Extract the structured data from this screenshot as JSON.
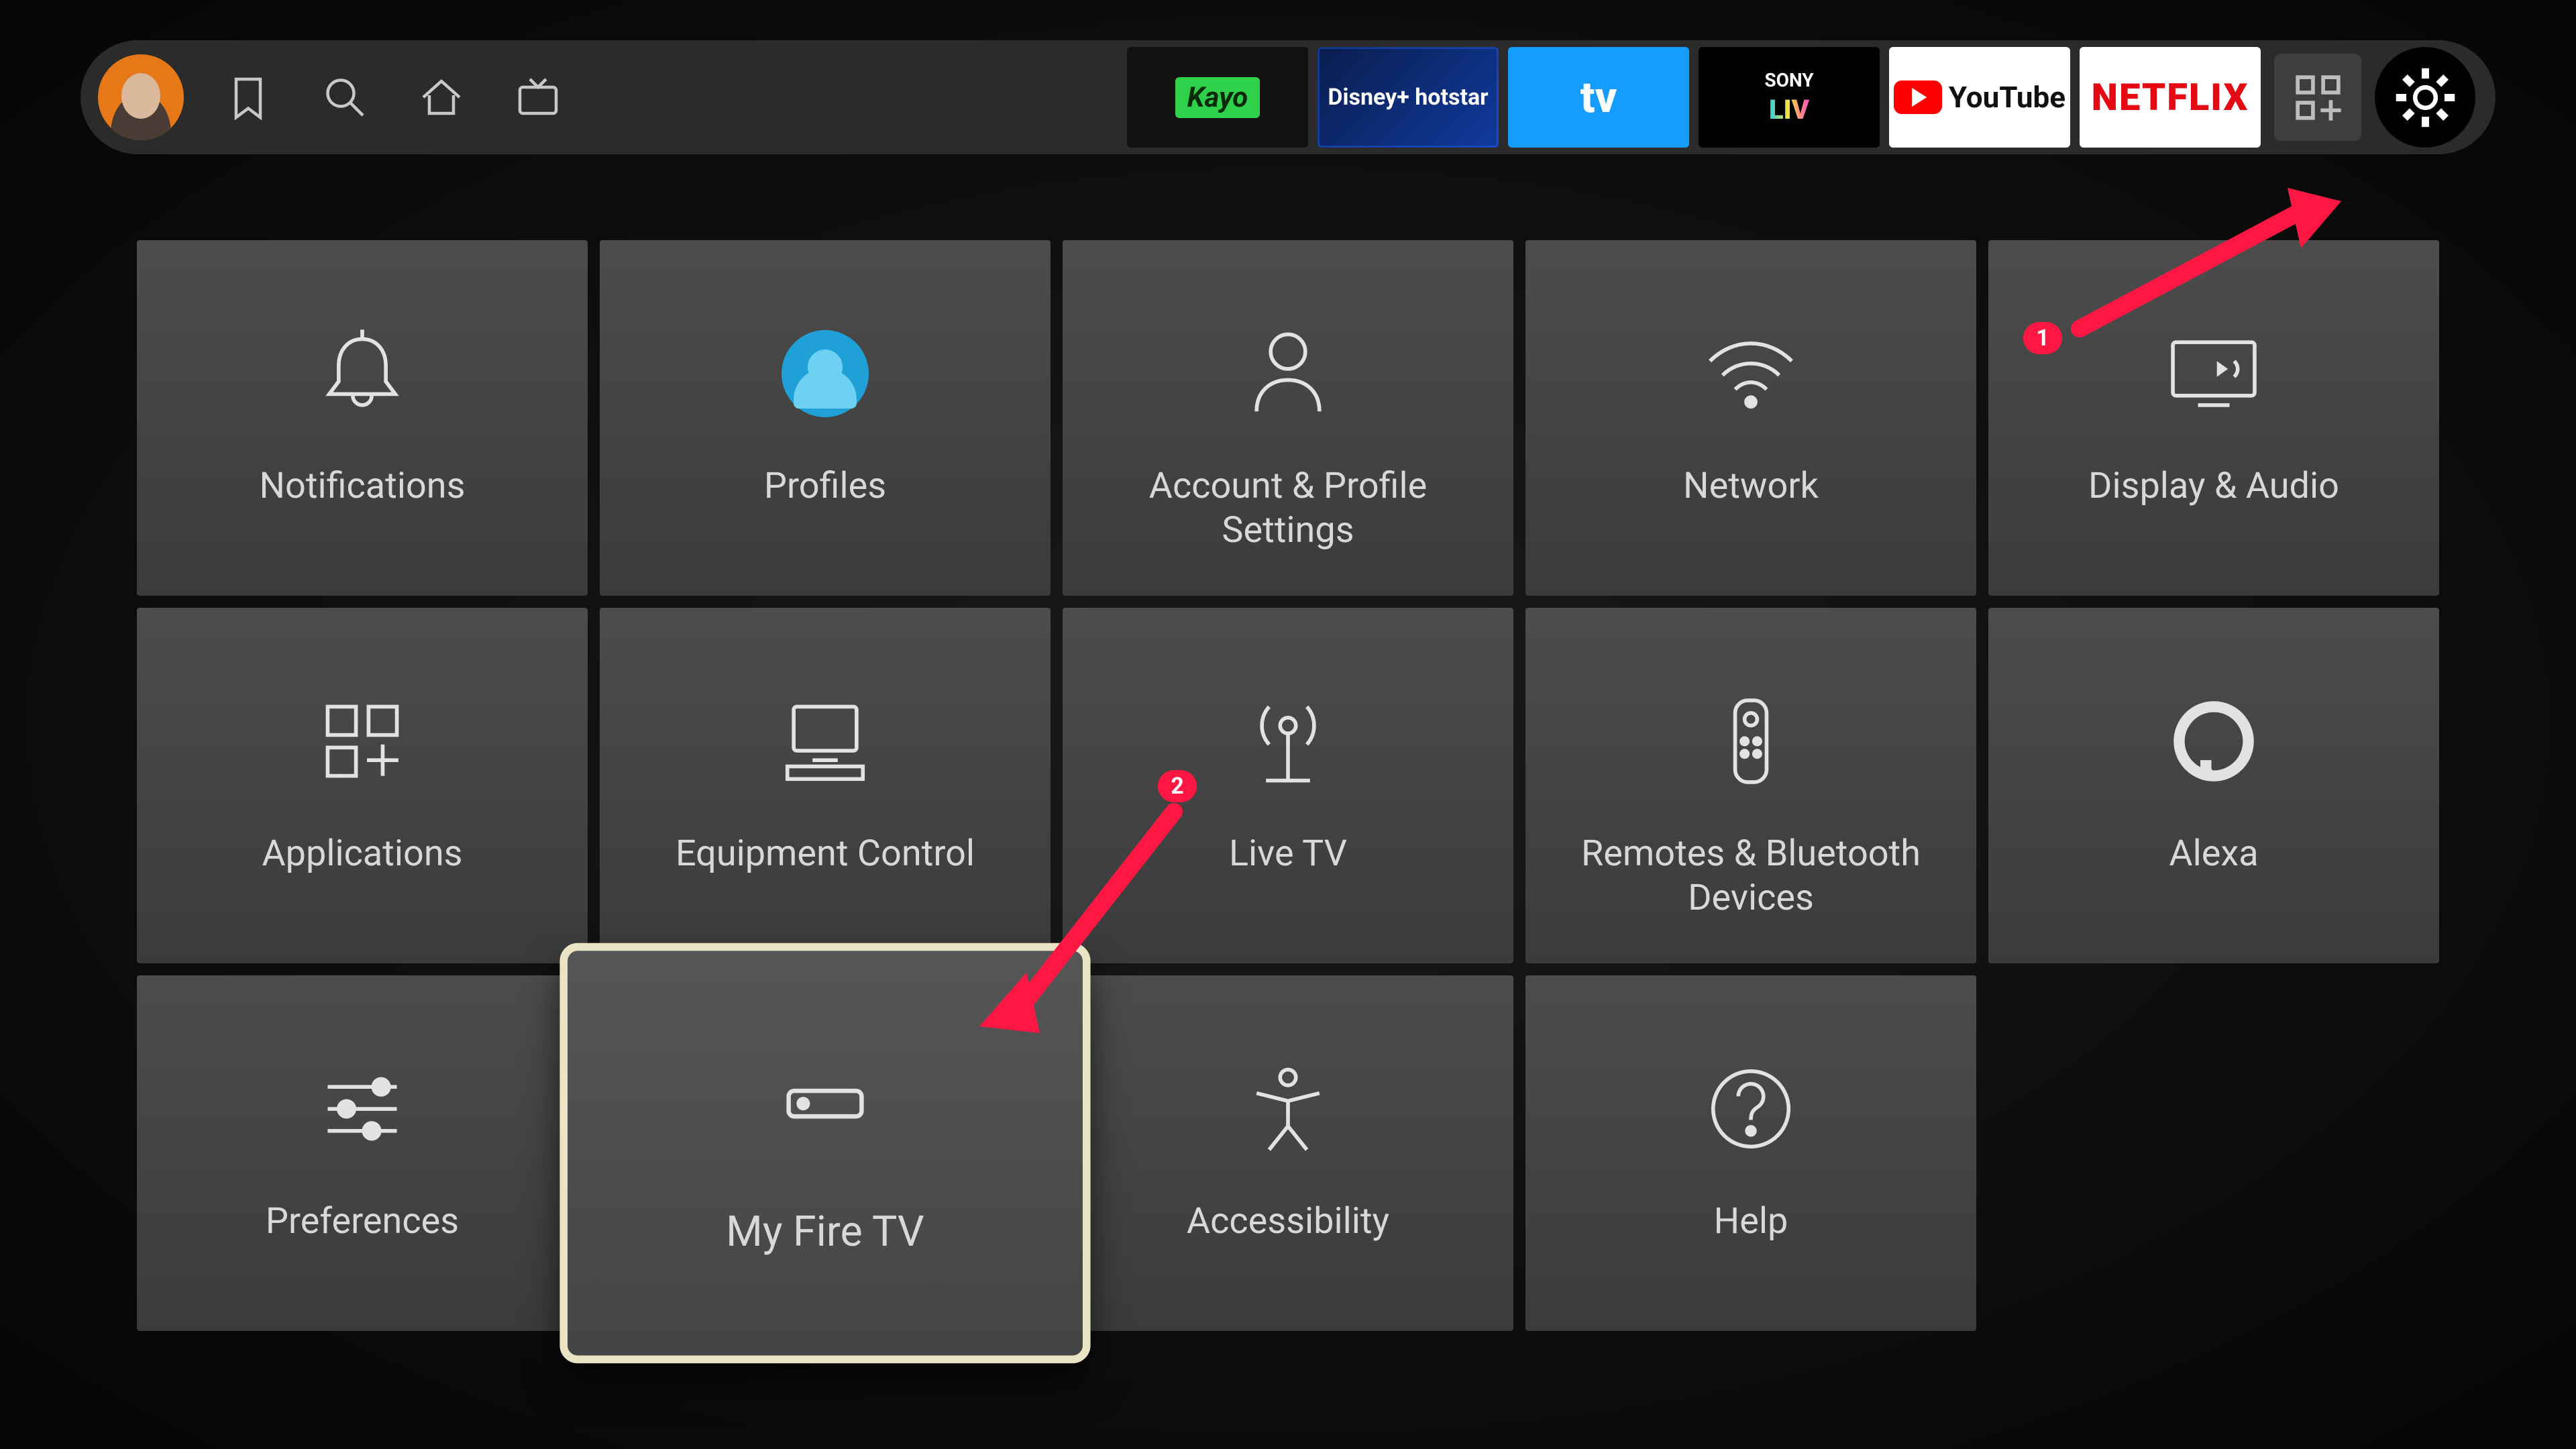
{
  "nav": {
    "apps": [
      {
        "id": "kayo",
        "label": "Kayo"
      },
      {
        "id": "hotstar",
        "label": "Disney+ hotstar"
      },
      {
        "id": "tv",
        "label": "tv"
      },
      {
        "id": "sony",
        "label_top": "SONY",
        "label_bottom": "LIV"
      },
      {
        "id": "youtube",
        "label": "YouTube"
      },
      {
        "id": "netflix",
        "label": "NETFLIX"
      }
    ]
  },
  "settings": {
    "tiles": [
      {
        "id": "notifications",
        "label": "Notifications",
        "icon": "bell"
      },
      {
        "id": "profiles",
        "label": "Profiles",
        "icon": "profile"
      },
      {
        "id": "account",
        "label": "Account & Profile Settings",
        "icon": "person"
      },
      {
        "id": "network",
        "label": "Network",
        "icon": "wifi"
      },
      {
        "id": "display-audio",
        "label": "Display & Audio",
        "icon": "tv-audio"
      },
      {
        "id": "applications",
        "label": "Applications",
        "icon": "apps-add"
      },
      {
        "id": "equipment-control",
        "label": "Equipment Control",
        "icon": "equipment"
      },
      {
        "id": "live-tv",
        "label": "Live TV",
        "icon": "antenna"
      },
      {
        "id": "remotes",
        "label": "Remotes & Bluetooth Devices",
        "icon": "remote"
      },
      {
        "id": "alexa",
        "label": "Alexa",
        "icon": "alexa"
      },
      {
        "id": "preferences",
        "label": "Preferences",
        "icon": "sliders"
      },
      {
        "id": "my-fire-tv",
        "label": "My Fire TV",
        "icon": "device",
        "selected": true
      },
      {
        "id": "accessibility",
        "label": "Accessibility",
        "icon": "accessibility"
      },
      {
        "id": "help",
        "label": "Help",
        "icon": "help"
      }
    ]
  },
  "annotations": {
    "badge1": "1",
    "badge2": "2"
  }
}
